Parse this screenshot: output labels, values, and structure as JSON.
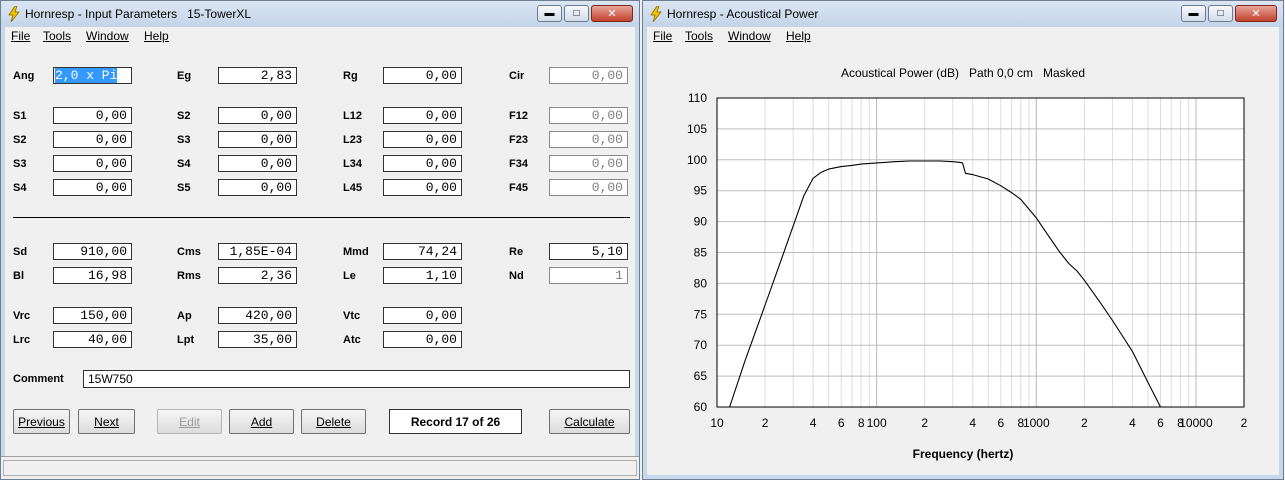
{
  "input_window": {
    "title": "Hornresp - Input Parameters   15-TowerXL",
    "menu": [
      "File",
      "Tools",
      "Window",
      "Help"
    ],
    "params": [
      {
        "label": "Ang",
        "value": "2,0 x Pi",
        "selected": true
      },
      {
        "label": "Eg",
        "value": "2,83"
      },
      {
        "label": "Rg",
        "value": "0,00"
      },
      {
        "label": "Cir",
        "value": "0,00",
        "disabled": true
      },
      {
        "label": "S1",
        "value": "0,00"
      },
      {
        "label": "S2",
        "value": "0,00"
      },
      {
        "label": "L12",
        "value": "0,00"
      },
      {
        "label": "F12",
        "value": "0,00",
        "disabled": true
      },
      {
        "label": "S2",
        "value": "0,00"
      },
      {
        "label": "S3",
        "value": "0,00"
      },
      {
        "label": "L23",
        "value": "0,00"
      },
      {
        "label": "F23",
        "value": "0,00",
        "disabled": true
      },
      {
        "label": "S3",
        "value": "0,00"
      },
      {
        "label": "S4",
        "value": "0,00"
      },
      {
        "label": "L34",
        "value": "0,00"
      },
      {
        "label": "F34",
        "value": "0,00",
        "disabled": true
      },
      {
        "label": "S4",
        "value": "0,00"
      },
      {
        "label": "S5",
        "value": "0,00"
      },
      {
        "label": "L45",
        "value": "0,00"
      },
      {
        "label": "F45",
        "value": "0,00",
        "disabled": true
      },
      {
        "label": "Sd",
        "value": "910,00"
      },
      {
        "label": "Cms",
        "value": "1,85E-04"
      },
      {
        "label": "Mmd",
        "value": "74,24"
      },
      {
        "label": "Re",
        "value": "5,10"
      },
      {
        "label": "Bl",
        "value": "16,98"
      },
      {
        "label": "Rms",
        "value": "2,36"
      },
      {
        "label": "Le",
        "value": "1,10"
      },
      {
        "label": "Nd",
        "value": "1",
        "disabled": true
      },
      {
        "label": "Vrc",
        "value": "150,00"
      },
      {
        "label": "Ap",
        "value": "420,00"
      },
      {
        "label": "Vtc",
        "value": "0,00"
      },
      {
        "label": "Lrc",
        "value": "40,00"
      },
      {
        "label": "Lpt",
        "value": "35,00"
      },
      {
        "label": "Atc",
        "value": "0,00"
      }
    ],
    "comment_label": "Comment",
    "comment_value": "15W750",
    "buttons": {
      "previous": "Previous",
      "next": "Next",
      "edit": "Edit",
      "add": "Add",
      "delete": "Delete",
      "calculate": "Calculate"
    },
    "record": "Record 17 of 26"
  },
  "power_window": {
    "title": "Hornresp - Acoustical Power",
    "menu": [
      "File",
      "Tools",
      "Window",
      "Help"
    ],
    "chart_title": "Acoustical Power (dB)   Path 0,0 cm   Masked"
  },
  "chart_data": {
    "type": "line",
    "title": "Acoustical Power (dB)   Path 0,0 cm   Masked",
    "xlabel": "Frequency (hertz)",
    "ylabel": "",
    "x_scale": "log",
    "xlim": [
      10,
      20000
    ],
    "ylim": [
      60,
      110
    ],
    "yticks": [
      60,
      65,
      70,
      75,
      80,
      85,
      90,
      95,
      100,
      105,
      110
    ],
    "xtick_labels": [
      {
        "x": 10,
        "label": "10"
      },
      {
        "x": 20,
        "label": "2"
      },
      {
        "x": 40,
        "label": "4"
      },
      {
        "x": 60,
        "label": "6"
      },
      {
        "x": 80,
        "label": "8"
      },
      {
        "x": 100,
        "label": "100"
      },
      {
        "x": 200,
        "label": "2"
      },
      {
        "x": 400,
        "label": "4"
      },
      {
        "x": 600,
        "label": "6"
      },
      {
        "x": 800,
        "label": "8"
      },
      {
        "x": 1000,
        "label": "1000"
      },
      {
        "x": 2000,
        "label": "2"
      },
      {
        "x": 4000,
        "label": "4"
      },
      {
        "x": 6000,
        "label": "6"
      },
      {
        "x": 8000,
        "label": "8"
      },
      {
        "x": 10000,
        "label": "10000"
      },
      {
        "x": 20000,
        "label": "2"
      }
    ],
    "grid": true,
    "series": [
      {
        "x": [
          12,
          15,
          20,
          25,
          30,
          35,
          40,
          45,
          50,
          60,
          70,
          80,
          100,
          130,
          160,
          200,
          250,
          300,
          330,
          345,
          360,
          400,
          500,
          600,
          700,
          800,
          1000,
          1200,
          1400,
          1600,
          1800,
          2000,
          2500,
          3000,
          4000,
          5000,
          6000
        ],
        "y": [
          60,
          67.5,
          76.5,
          83.5,
          89.3,
          94.2,
          97,
          98,
          98.5,
          98.9,
          99.1,
          99.3,
          99.5,
          99.7,
          99.8,
          99.8,
          99.8,
          99.7,
          99.6,
          99.5,
          97.8,
          97.6,
          96.9,
          95.8,
          94.7,
          93.6,
          90.6,
          87.6,
          85.1,
          83.2,
          82,
          80.5,
          77,
          74,
          69,
          64,
          60
        ]
      }
    ]
  }
}
